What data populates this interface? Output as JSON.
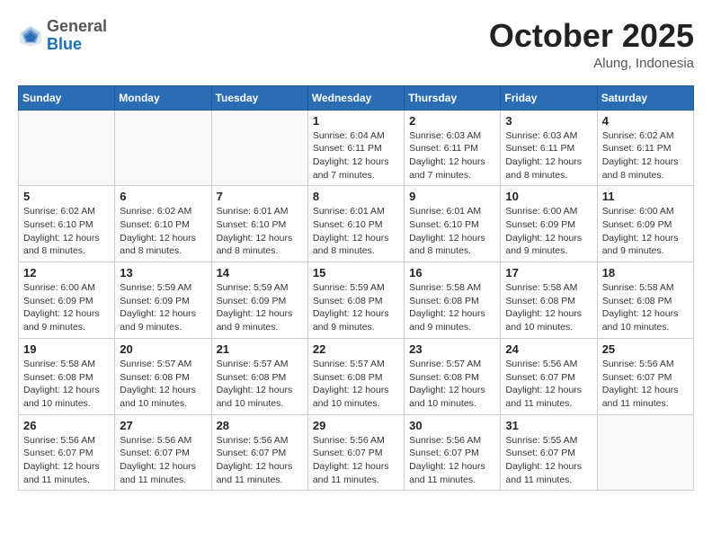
{
  "header": {
    "logo_general": "General",
    "logo_blue": "Blue",
    "month_title": "October 2025",
    "location": "Alung, Indonesia"
  },
  "days_of_week": [
    "Sunday",
    "Monday",
    "Tuesday",
    "Wednesday",
    "Thursday",
    "Friday",
    "Saturday"
  ],
  "weeks": [
    [
      {
        "day": "",
        "info": ""
      },
      {
        "day": "",
        "info": ""
      },
      {
        "day": "",
        "info": ""
      },
      {
        "day": "1",
        "info": "Sunrise: 6:04 AM\nSunset: 6:11 PM\nDaylight: 12 hours\nand 7 minutes."
      },
      {
        "day": "2",
        "info": "Sunrise: 6:03 AM\nSunset: 6:11 PM\nDaylight: 12 hours\nand 7 minutes."
      },
      {
        "day": "3",
        "info": "Sunrise: 6:03 AM\nSunset: 6:11 PM\nDaylight: 12 hours\nand 8 minutes."
      },
      {
        "day": "4",
        "info": "Sunrise: 6:02 AM\nSunset: 6:11 PM\nDaylight: 12 hours\nand 8 minutes."
      }
    ],
    [
      {
        "day": "5",
        "info": "Sunrise: 6:02 AM\nSunset: 6:10 PM\nDaylight: 12 hours\nand 8 minutes."
      },
      {
        "day": "6",
        "info": "Sunrise: 6:02 AM\nSunset: 6:10 PM\nDaylight: 12 hours\nand 8 minutes."
      },
      {
        "day": "7",
        "info": "Sunrise: 6:01 AM\nSunset: 6:10 PM\nDaylight: 12 hours\nand 8 minutes."
      },
      {
        "day": "8",
        "info": "Sunrise: 6:01 AM\nSunset: 6:10 PM\nDaylight: 12 hours\nand 8 minutes."
      },
      {
        "day": "9",
        "info": "Sunrise: 6:01 AM\nSunset: 6:10 PM\nDaylight: 12 hours\nand 8 minutes."
      },
      {
        "day": "10",
        "info": "Sunrise: 6:00 AM\nSunset: 6:09 PM\nDaylight: 12 hours\nand 9 minutes."
      },
      {
        "day": "11",
        "info": "Sunrise: 6:00 AM\nSunset: 6:09 PM\nDaylight: 12 hours\nand 9 minutes."
      }
    ],
    [
      {
        "day": "12",
        "info": "Sunrise: 6:00 AM\nSunset: 6:09 PM\nDaylight: 12 hours\nand 9 minutes."
      },
      {
        "day": "13",
        "info": "Sunrise: 5:59 AM\nSunset: 6:09 PM\nDaylight: 12 hours\nand 9 minutes."
      },
      {
        "day": "14",
        "info": "Sunrise: 5:59 AM\nSunset: 6:09 PM\nDaylight: 12 hours\nand 9 minutes."
      },
      {
        "day": "15",
        "info": "Sunrise: 5:59 AM\nSunset: 6:08 PM\nDaylight: 12 hours\nand 9 minutes."
      },
      {
        "day": "16",
        "info": "Sunrise: 5:58 AM\nSunset: 6:08 PM\nDaylight: 12 hours\nand 9 minutes."
      },
      {
        "day": "17",
        "info": "Sunrise: 5:58 AM\nSunset: 6:08 PM\nDaylight: 12 hours\nand 10 minutes."
      },
      {
        "day": "18",
        "info": "Sunrise: 5:58 AM\nSunset: 6:08 PM\nDaylight: 12 hours\nand 10 minutes."
      }
    ],
    [
      {
        "day": "19",
        "info": "Sunrise: 5:58 AM\nSunset: 6:08 PM\nDaylight: 12 hours\nand 10 minutes."
      },
      {
        "day": "20",
        "info": "Sunrise: 5:57 AM\nSunset: 6:08 PM\nDaylight: 12 hours\nand 10 minutes."
      },
      {
        "day": "21",
        "info": "Sunrise: 5:57 AM\nSunset: 6:08 PM\nDaylight: 12 hours\nand 10 minutes."
      },
      {
        "day": "22",
        "info": "Sunrise: 5:57 AM\nSunset: 6:08 PM\nDaylight: 12 hours\nand 10 minutes."
      },
      {
        "day": "23",
        "info": "Sunrise: 5:57 AM\nSunset: 6:08 PM\nDaylight: 12 hours\nand 10 minutes."
      },
      {
        "day": "24",
        "info": "Sunrise: 5:56 AM\nSunset: 6:07 PM\nDaylight: 12 hours\nand 11 minutes."
      },
      {
        "day": "25",
        "info": "Sunrise: 5:56 AM\nSunset: 6:07 PM\nDaylight: 12 hours\nand 11 minutes."
      }
    ],
    [
      {
        "day": "26",
        "info": "Sunrise: 5:56 AM\nSunset: 6:07 PM\nDaylight: 12 hours\nand 11 minutes."
      },
      {
        "day": "27",
        "info": "Sunrise: 5:56 AM\nSunset: 6:07 PM\nDaylight: 12 hours\nand 11 minutes."
      },
      {
        "day": "28",
        "info": "Sunrise: 5:56 AM\nSunset: 6:07 PM\nDaylight: 12 hours\nand 11 minutes."
      },
      {
        "day": "29",
        "info": "Sunrise: 5:56 AM\nSunset: 6:07 PM\nDaylight: 12 hours\nand 11 minutes."
      },
      {
        "day": "30",
        "info": "Sunrise: 5:56 AM\nSunset: 6:07 PM\nDaylight: 12 hours\nand 11 minutes."
      },
      {
        "day": "31",
        "info": "Sunrise: 5:55 AM\nSunset: 6:07 PM\nDaylight: 12 hours\nand 11 minutes."
      },
      {
        "day": "",
        "info": ""
      }
    ]
  ]
}
